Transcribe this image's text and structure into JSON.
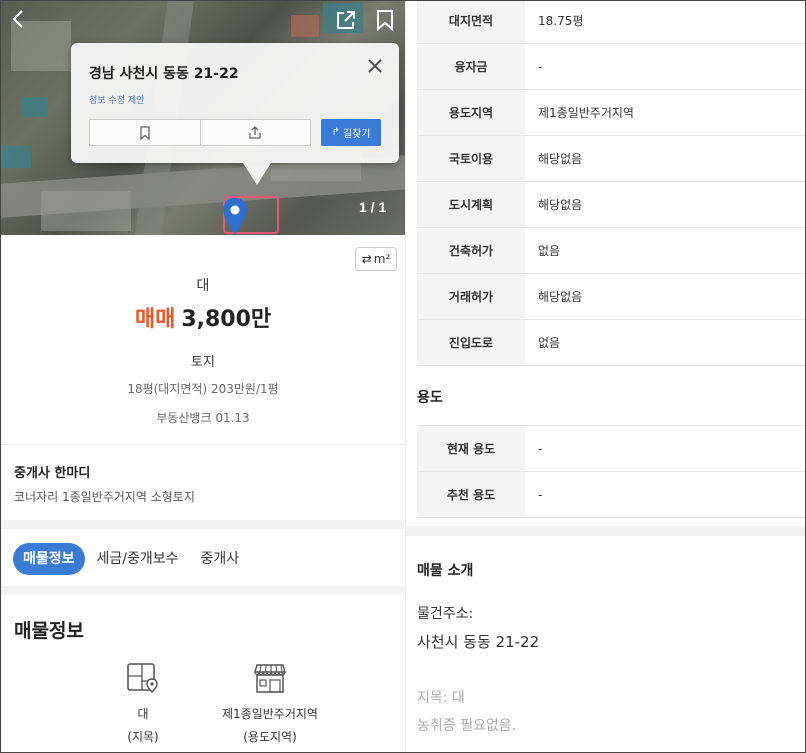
{
  "map": {
    "counter": "1 / 1",
    "popup": {
      "title": "경남 사천시 동동 21-22",
      "edit_link": "정보 수정 제안",
      "route_label": "길찾기"
    }
  },
  "summary": {
    "unit_toggle": "m²",
    "land_type": "대",
    "deal_type": "매매",
    "price": "3,800만",
    "category": "토지",
    "area_line": "18평(대지면적)  203만원/1평",
    "source_line": "부동산뱅크 01.13"
  },
  "agent_comment": {
    "title": "중개사 한마디",
    "text": "코너자리 1종일반주거지역 소형토지"
  },
  "tabs": [
    {
      "label": "매물정보",
      "active": true
    },
    {
      "label": "세금/중개보수",
      "active": false
    },
    {
      "label": "중개사",
      "active": false
    }
  ],
  "listing_info": {
    "heading": "매물정보",
    "items": [
      {
        "value": "대",
        "key": "(지목)",
        "icon": "map-pin-icon"
      },
      {
        "value": "제1종일반주거지역",
        "key": "(용도지역)",
        "icon": "building-icon"
      }
    ]
  },
  "detail_table": [
    {
      "label": "대지면적",
      "value": "18.75평"
    },
    {
      "label": "융자금",
      "value": "-"
    },
    {
      "label": "용도지역",
      "value": "제1종일반주거지역"
    },
    {
      "label": "국토이용",
      "value": "해당없음"
    },
    {
      "label": "도시계획",
      "value": "해당없음"
    },
    {
      "label": "건축허가",
      "value": "없음"
    },
    {
      "label": "거래허가",
      "value": "해당없음"
    },
    {
      "label": "진입도로",
      "value": "없음"
    }
  ],
  "usage": {
    "heading": "용도",
    "rows": [
      {
        "label": "현재 용도",
        "value": "-"
      },
      {
        "label": "추천 용도",
        "value": "-"
      }
    ]
  },
  "intro": {
    "heading": "매물 소개",
    "address_label": "물건주소:",
    "address_value": "사천시 동동 21-22",
    "land_category": "지목: 대",
    "note": "농취증 필요없음."
  },
  "colors": {
    "accent_blue": "#3a7bd5",
    "deal_orange": "#e85a2a"
  }
}
